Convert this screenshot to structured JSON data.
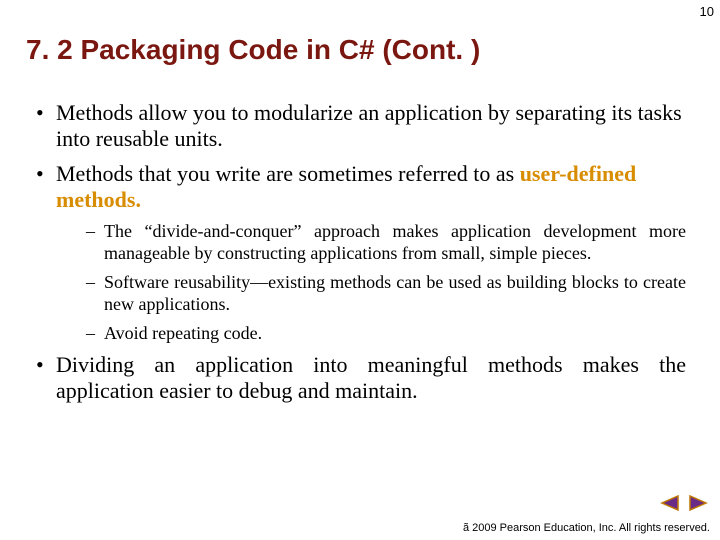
{
  "page_number": "10",
  "title": "7. 2  Packaging Code in C# (Cont. )",
  "bullets": {
    "b1": "Methods allow you to modularize an application by separating its tasks into reusable units.",
    "b2_before": "Methods that you write are sometimes referred to as ",
    "b2_highlight": "user-defined methods.",
    "sub1": "The “divide-and-conquer” approach makes application development more manageable by constructing applications from small, simple pieces.",
    "sub2": "Software reusability—existing methods can be used as building blocks to create new applications.",
    "sub3": "Avoid repeating code.",
    "b3": "Dividing an application into meaningful methods makes the application easier to debug and maintain."
  },
  "footer": "ã 2009 Pearson Education, Inc.  All rights reserved.",
  "colors": {
    "title": "#7a1710",
    "highlight": "#D88C00",
    "nav_outline": "#be7800",
    "nav_fill": "#6a2b86"
  }
}
